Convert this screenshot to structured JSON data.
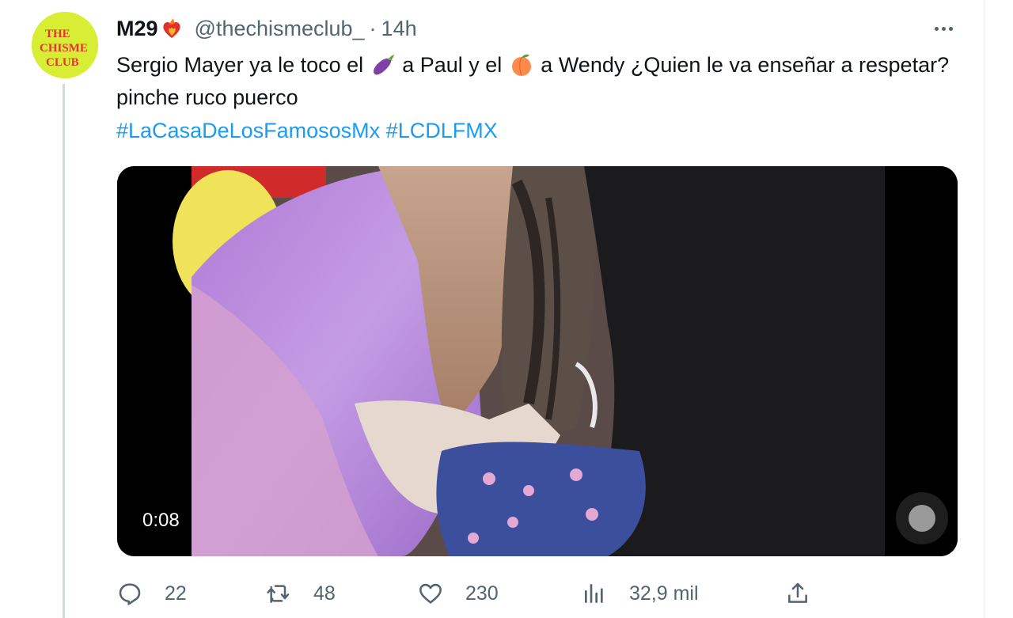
{
  "author": {
    "display_name": "M29",
    "handle": "@thechismeclub_",
    "separator": "·",
    "time": "14h",
    "avatar_text": [
      "THE",
      "CHISME",
      "CLUB"
    ]
  },
  "tweet": {
    "text_part1": "Sergio Mayer ya le toco el",
    "emoji1": "eggplant-emoji",
    "text_part2": "a Paul y el",
    "emoji2": "peach-emoji",
    "text_part3": "a Wendy ¿Quien le va enseñar a respetar? pinche ruco puerco",
    "hashtags": [
      "#LaCasaDeLosFamososMx",
      "#LCDLFMX"
    ]
  },
  "media": {
    "type": "video",
    "timestamp": "0:08"
  },
  "actions": {
    "replies": "22",
    "retweets": "48",
    "likes": "230",
    "views": "32,9 mil"
  },
  "colors": {
    "accent": "#1d9bf0",
    "secondary_text": "#536471",
    "primary_text": "#0f1419",
    "avatar_bg": "#d8ee34"
  }
}
